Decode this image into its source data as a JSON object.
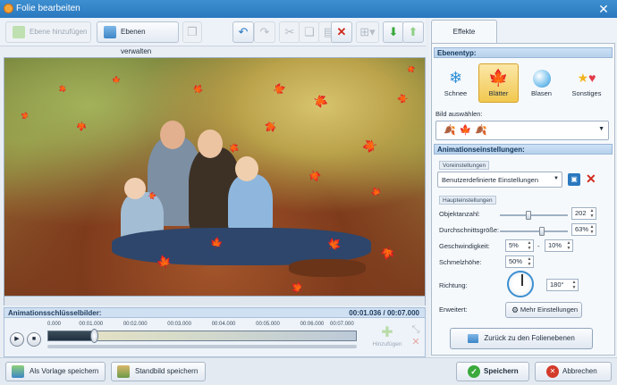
{
  "window": {
    "title": "Folie bearbeiten",
    "close_glyph": "✕"
  },
  "toolbar": {
    "add_layer_label": "Ebene hinzufügen",
    "manage_layers_label": "Ebenen verwalten"
  },
  "timeline": {
    "title": "Animationsschlüsselbilder:",
    "time_display": "00:01.036 / 00:07.000",
    "ticks": [
      "0.000",
      "00:01.000",
      "00:02.000",
      "00:03.000",
      "00:04.000",
      "00:05.000",
      "00:06.000",
      "00:07.000"
    ],
    "position_fraction": 0.148,
    "add_keyframe_label": "Hinzufügen"
  },
  "bottom": {
    "save_template_label": "Als Vorlage speichern",
    "save_still_label": "Standbild speichern",
    "save_label": "Speichern",
    "cancel_label": "Abbrechen"
  },
  "panel": {
    "tab_label": "Effekte",
    "layer_type_header": "Ebenentyp:",
    "layer_types": [
      {
        "label": "Schnee",
        "icon": "snowflake-icon",
        "selected": false
      },
      {
        "label": "Blätter",
        "icon": "leaf-icon",
        "selected": true
      },
      {
        "label": "Blasen",
        "icon": "bubble-icon",
        "selected": false
      },
      {
        "label": "Sonstiges",
        "icon": "star-heart-icon",
        "selected": false
      }
    ],
    "choose_image_label": "Bild auswählen:",
    "animation_header": "Animationseinstellungen:",
    "presets_subheader": "Voreinstellungen",
    "preset_value": "Benutzerdefinierte Einstellungen",
    "main_subheader": "Haupteinstellungen",
    "object_count": {
      "label": "Objektanzahl:",
      "value": "202",
      "slider_fraction": 0.42
    },
    "avg_size": {
      "label": "Durchschnittsgröße:",
      "value": "63%",
      "slider_fraction": 0.63
    },
    "speed": {
      "label": "Geschwindigkeit:",
      "from": "5%",
      "dash": "-",
      "to": "10%"
    },
    "wave_height": {
      "label": "Schmelzhöhe:",
      "value": "50%"
    },
    "direction": {
      "label": "Richtung:",
      "value": "180°"
    },
    "advanced": {
      "label": "Erweitert:",
      "button_label": "Mehr Einstellungen"
    },
    "back_label": "Zurück zu den Folienebenen"
  },
  "colors": {
    "accent": "#2a78bf",
    "selected_tile": "#f1c84f",
    "leaf": "#d9481c"
  }
}
